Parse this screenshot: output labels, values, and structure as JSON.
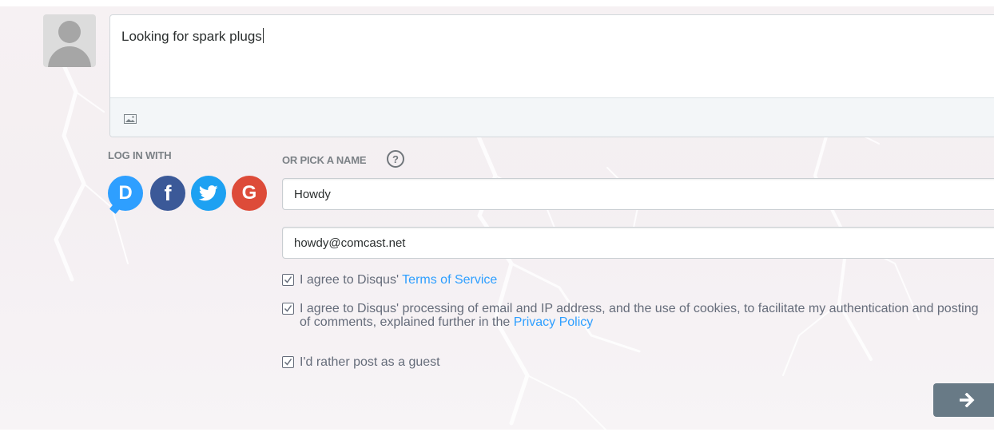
{
  "composer": {
    "text": "Looking for spark plugs",
    "image_icon": "image-icon"
  },
  "login": {
    "label": "LOG IN WITH",
    "providers": [
      {
        "name": "disqus",
        "glyph": "D",
        "color": "#2e9fff"
      },
      {
        "name": "facebook",
        "glyph": "f",
        "color": "#3b5998"
      },
      {
        "name": "twitter",
        "glyph": "twitter-bird-icon",
        "color": "#1da1f2"
      },
      {
        "name": "google",
        "glyph": "G",
        "color": "#dd4b39"
      }
    ]
  },
  "guest": {
    "label": "OR PICK A NAME",
    "help_glyph": "?",
    "name_value": "Howdy",
    "email_value": "howdy@comcast.net"
  },
  "consents": {
    "terms_prefix": "I agree to Disqus' ",
    "terms_link": "Terms of Service",
    "privacy_text": "I agree to Disqus' processing of email and IP address, and the use of cookies, to facilitate my authentication and posting of comments, explained further in the ",
    "privacy_link": "Privacy Policy",
    "guest_text": "I'd rather post as a guest",
    "terms_checked": true,
    "privacy_checked": true,
    "guest_checked": true
  },
  "submit": {
    "icon": "arrow-right-icon",
    "color": "#687a86"
  },
  "colors": {
    "link": "#2e9fff",
    "label_gray": "#7b8186"
  }
}
